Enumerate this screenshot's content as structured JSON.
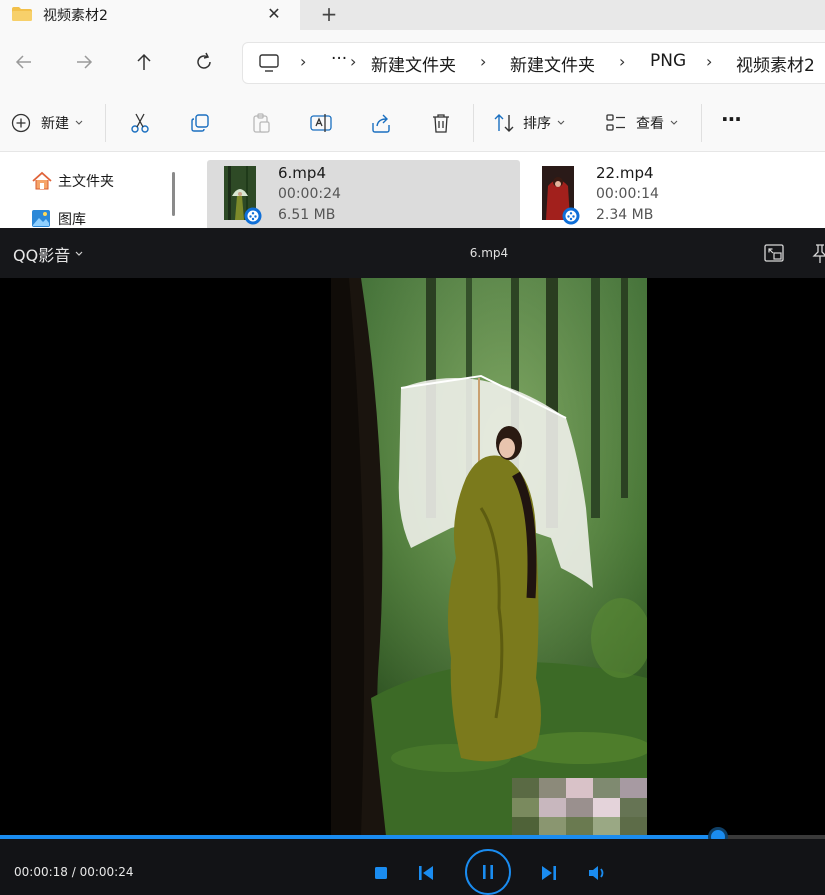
{
  "explorer": {
    "tab": {
      "title": "视频素材2",
      "close": "✕",
      "new_tab": "+"
    },
    "address": {
      "more": "···",
      "crumbs": [
        "新建文件夹",
        "新建文件夹",
        "PNG",
        "视频素材2"
      ],
      "sep": "›"
    },
    "toolbar": {
      "new_label": "新建",
      "sort_label": "排序",
      "view_label": "查看",
      "more": "···"
    },
    "sidebar": {
      "items": [
        "主文件夹",
        "图库"
      ]
    },
    "files": [
      {
        "name": "6.mp4",
        "duration": "00:00:24",
        "size": "6.51 MB",
        "selected": true
      },
      {
        "name": "22.mp4",
        "duration": "00:00:14",
        "size": "2.34 MB",
        "selected": false
      }
    ]
  },
  "player": {
    "brand": "QQ影音",
    "title": "6.mp4",
    "current_time": "00:00:18",
    "total_time": "00:00:24",
    "time_sep": " / ",
    "progress": 0.87,
    "accent": "#1a8cf0"
  }
}
